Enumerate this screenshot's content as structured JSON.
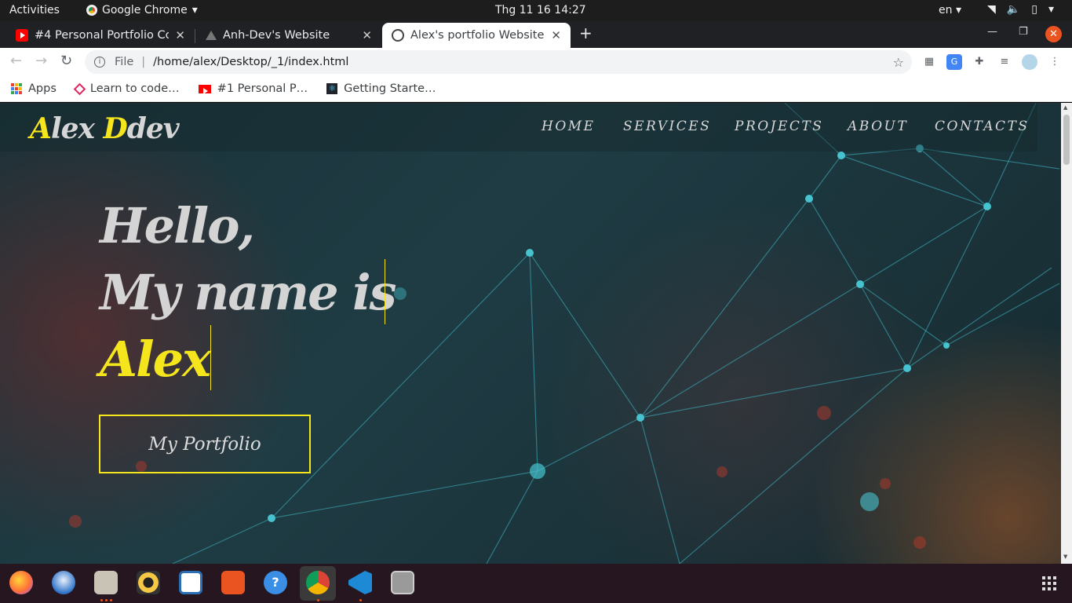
{
  "system": {
    "activities": "Activities",
    "app_name": "Google Chrome",
    "clock": "Thg 11 16  14:27",
    "lang": "en"
  },
  "tabs": [
    {
      "title": "#4 Personal Portfolio Cor",
      "favicon": "youtube-icon"
    },
    {
      "title": "Anh-Dev's Website",
      "favicon": "triangle-icon"
    },
    {
      "title": "Alex's portfolio Website",
      "favicon": "globe-icon",
      "active": true
    }
  ],
  "toolbar": {
    "scheme": "File",
    "url": "/home/alex/Desktop/_1/index.html"
  },
  "bookmarks": [
    {
      "label": "Apps",
      "icon": "apps-grid-icon"
    },
    {
      "label": "Learn to code…",
      "icon": "freecodecamp-icon"
    },
    {
      "label": "#1 Personal P…",
      "icon": "youtube-icon"
    },
    {
      "label": "Getting Starte…",
      "icon": "react-icon"
    }
  ],
  "site": {
    "logo_first": "A",
    "logo_rest1": "lex ",
    "logo_d": "D",
    "logo_rest2": "dev",
    "menu": [
      "HOME",
      "SERVICES",
      "PROJECTS",
      "ABOUT",
      "CONTACTS"
    ],
    "hero_line1": "Hello,",
    "hero_line2": "My name is",
    "hero_name": "Alex",
    "button": "My Portfolio"
  },
  "colors": {
    "accent": "#f4e51c",
    "ubuntu_orange": "#e95420"
  },
  "dock": [
    "firefox-icon",
    "thunderbird-icon",
    "files-icon",
    "rhythmbox-icon",
    "writer-icon",
    "software-icon",
    "help-icon",
    "chrome-icon",
    "vscode-icon",
    "disk-icon"
  ]
}
